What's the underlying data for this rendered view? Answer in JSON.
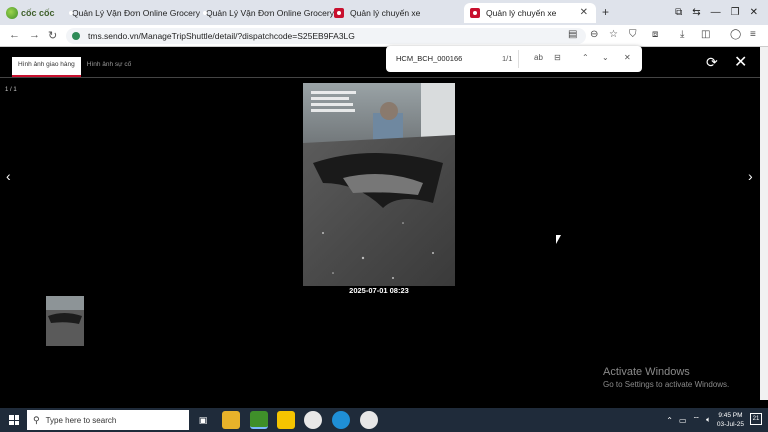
{
  "browser": {
    "brand": "cốc cốc",
    "tabs": [
      {
        "label": "Quản Lý Vận Đơn Online Grocery"
      },
      {
        "label": "Quản Lý Vận Đơn Online Grocery"
      },
      {
        "label": "Quản lý chuyến xe"
      },
      {
        "label": "Quản lý chuyến xe"
      }
    ],
    "url": "tms.sendo.vn/ManageTripShuttle/detail/?dispatchcode=S25EB9FA3LG"
  },
  "page": {
    "tabs": [
      {
        "label": "Hình ảnh giao hàng"
      },
      {
        "label": "Hình ảnh sự cố"
      }
    ],
    "counter": "1 / 1",
    "photo_caption": "2025-07-01 08:23"
  },
  "find_bar": {
    "query": "HCM_BCH_000166",
    "count": "1/1"
  },
  "watermark": {
    "title": "Activate Windows",
    "subtitle": "Go to Settings to activate Windows."
  },
  "taskbar": {
    "search_placeholder": "Type here to search",
    "time": "9:45 PM",
    "date": "03-Jul-25",
    "notifications": "21"
  }
}
